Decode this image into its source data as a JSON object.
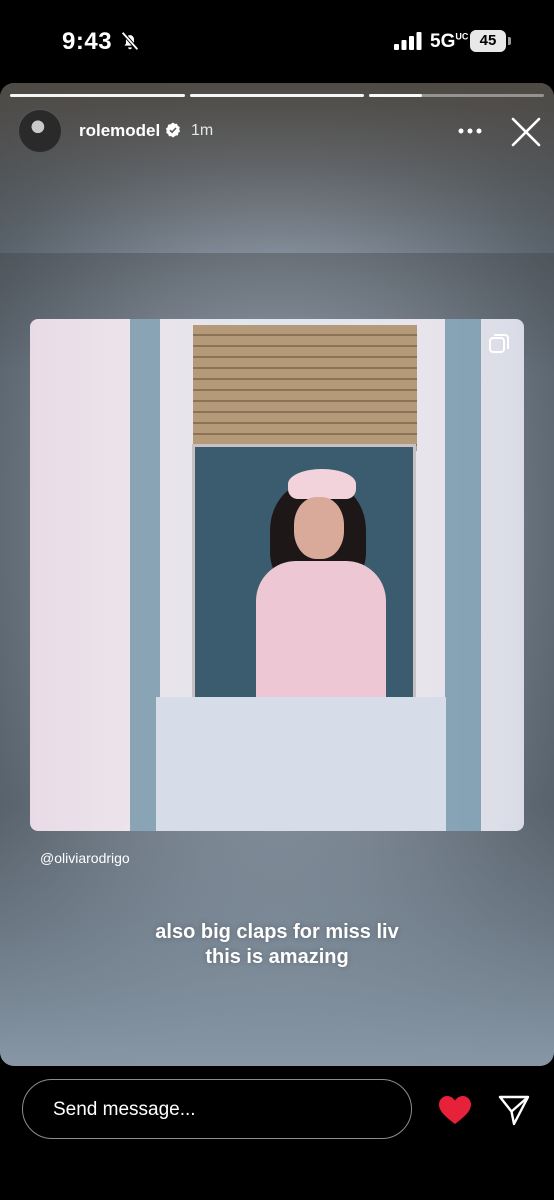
{
  "status_bar": {
    "time": "9:43",
    "network": "5G",
    "network_sup": "UC",
    "battery": "45",
    "icons": [
      "bell-muted-icon",
      "signal-icon",
      "battery-icon"
    ]
  },
  "story": {
    "progress": [
      1.0,
      1.0,
      0.3
    ],
    "username": "rolemodel",
    "verified": true,
    "time_ago": "1m",
    "mention": "@oliviarodrigo",
    "caption_line1": "also big claps for miss liv",
    "caption_line2": "this is amazing"
  },
  "composer": {
    "placeholder": "Send message..."
  },
  "colors": {
    "like": "#e8213a",
    "background": "#000000"
  }
}
